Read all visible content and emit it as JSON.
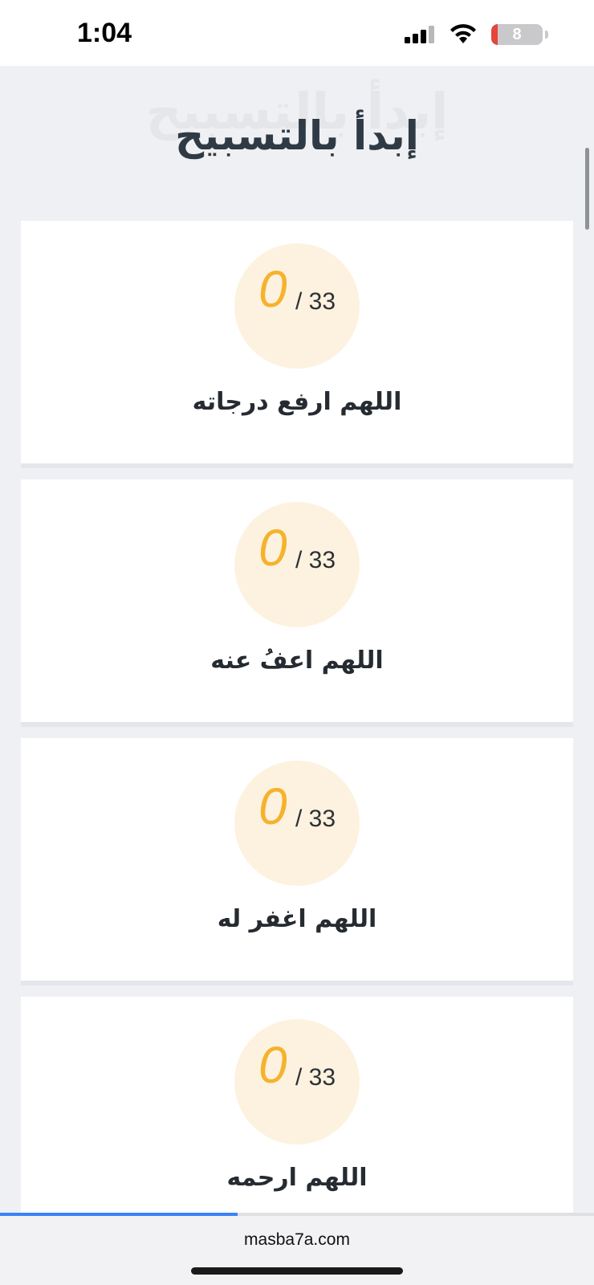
{
  "status_bar": {
    "time": "1:04",
    "battery_level": "8",
    "icons": [
      "signal-icon",
      "wifi-icon",
      "battery-icon"
    ]
  },
  "header": {
    "title": "إبدأ بالتسبيح"
  },
  "cards": [
    {
      "count": "0",
      "target": "/ 33",
      "label": "اللهم ارفع درجاته"
    },
    {
      "count": "0",
      "target": "/ 33",
      "label": "اللهم اعفُ عنه"
    },
    {
      "count": "0",
      "target": "/ 33",
      "label": "اللهم اغفر له"
    },
    {
      "count": "0",
      "target": "/ 33",
      "label": "اللهم ارحمه"
    }
  ],
  "browser": {
    "url": "masba7a.com",
    "load_progress": 0.4
  },
  "colors": {
    "accent": "#f6b22c",
    "counter_bg": "#fdf2df",
    "title": "#2f3a45",
    "progress": "#3b82f6"
  }
}
